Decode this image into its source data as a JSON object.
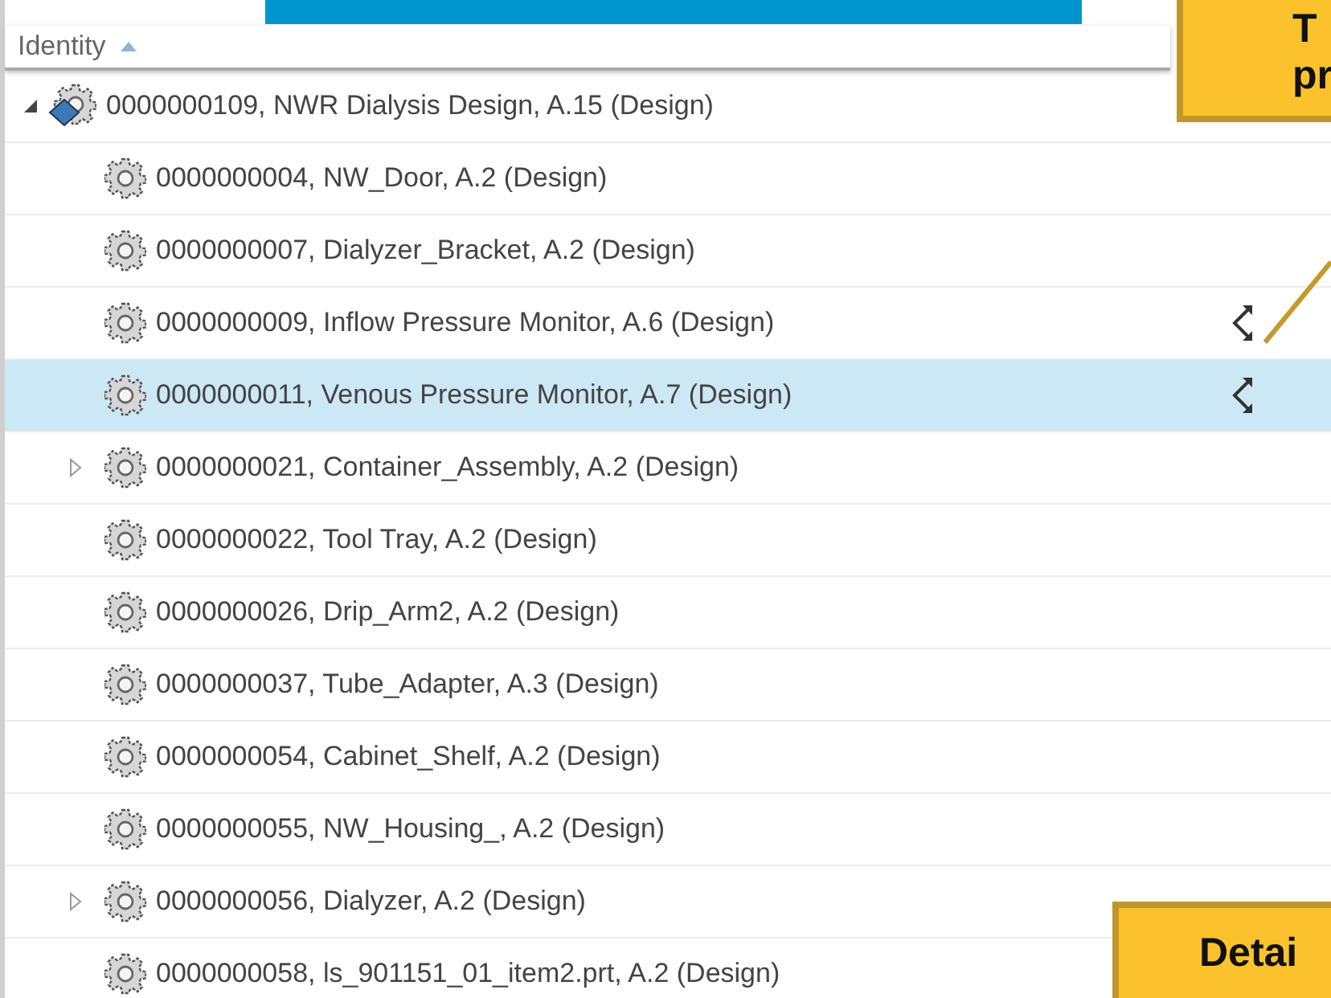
{
  "header": {
    "label": "Identity"
  },
  "tree": {
    "label": "0000000109, NWR Dialysis Design, A.15 (Design)",
    "expanded": true,
    "selected": false,
    "children": [
      {
        "label": "0000000004, NW_Door, A.2 (Design)",
        "has_children": false,
        "selected": false,
        "flagged": false
      },
      {
        "label": "0000000007, Dialyzer_Bracket, A.2 (Design)",
        "has_children": false,
        "selected": false,
        "flagged": false
      },
      {
        "label": "0000000009, Inflow Pressure Monitor, A.6 (Design)",
        "has_children": false,
        "selected": false,
        "flagged": true
      },
      {
        "label": "0000000011, Venous Pressure Monitor, A.7 (Design)",
        "has_children": false,
        "selected": true,
        "flagged": true
      },
      {
        "label": "0000000021, Container_Assembly, A.2 (Design)",
        "has_children": true,
        "selected": false,
        "flagged": false
      },
      {
        "label": "0000000022, Tool Tray, A.2 (Design)",
        "has_children": false,
        "selected": false,
        "flagged": false
      },
      {
        "label": "0000000026, Drip_Arm2, A.2 (Design)",
        "has_children": false,
        "selected": false,
        "flagged": false
      },
      {
        "label": "0000000037, Tube_Adapter, A.3 (Design)",
        "has_children": false,
        "selected": false,
        "flagged": false
      },
      {
        "label": "0000000054, Cabinet_Shelf, A.2 (Design)",
        "has_children": false,
        "selected": false,
        "flagged": false
      },
      {
        "label": "0000000055, NW_Housing_, A.2 (Design)",
        "has_children": false,
        "selected": false,
        "flagged": false
      },
      {
        "label": "0000000056, Dialyzer, A.2 (Design)",
        "has_children": true,
        "selected": false,
        "flagged": false
      },
      {
        "label": "0000000058, ls_901151_01_item2.prt, A.2 (Design)",
        "has_children": false,
        "selected": false
      }
    ]
  },
  "callouts": [
    {
      "kind": "top",
      "lines": [
        "T",
        "pr"
      ]
    },
    {
      "kind": "bottom",
      "lines": [
        "Detai"
      ]
    }
  ]
}
